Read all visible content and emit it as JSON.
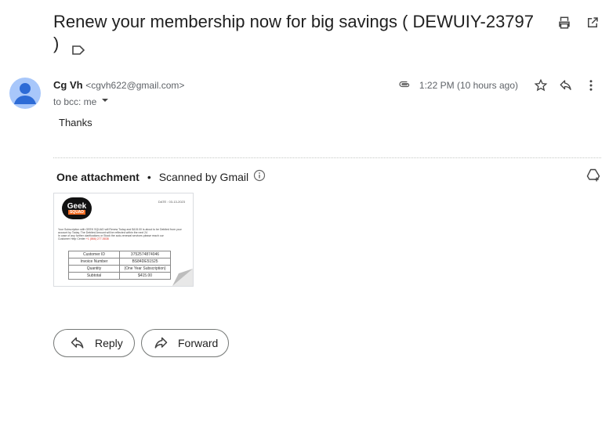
{
  "email": {
    "subject": "Renew your membership now for big savings ( DEWUIY-23797 )",
    "sender_name": "Cg Vh",
    "sender_email": "<cgvh622@gmail.com>",
    "recipient": "to bcc: me",
    "time": "1:22 PM (10 hours ago)",
    "body": "Thanks"
  },
  "attachments": {
    "count_label": "One attachment",
    "separator": "•",
    "scan_label": "Scanned by Gmail"
  },
  "thumbnail": {
    "logo_top": "Geek",
    "logo_bottom": "SQUAD",
    "date": "DATE : 03-13-2023",
    "paragraph_1": "Your Subscription with GEEK SQUAD will Renew Today and $415.00 is about to be Debited from your account by Today. The Debited Amount will be reflected within the next 24",
    "paragraph_2": "In case of any further clarifications or Stock the auto-renewal services please reach our",
    "paragraph_3": "Customer Help Center",
    "phone": "+1 (866) 277-5838",
    "rows": [
      {
        "label": "Customer ID",
        "value": "3752574874046"
      },
      {
        "label": "Invoice Number",
        "value": "BS84DE51525"
      },
      {
        "label": "Quantity",
        "value": "(One Year Subscription)"
      },
      {
        "label": "Subtotal",
        "value": "$415.00"
      }
    ]
  },
  "actions": {
    "reply": "Reply",
    "forward": "Forward"
  },
  "icons": [
    "label-icon",
    "print-icon",
    "open-in-new-icon",
    "attachment-icon",
    "star-icon",
    "reply-icon",
    "more-vert-icon",
    "dropdown-icon",
    "info-icon",
    "add-to-drive-icon",
    "forward-icon"
  ],
  "colors": {
    "avatar": "#a8c7fa",
    "logo_accent": "#f26b21",
    "button_border": "#747775"
  }
}
